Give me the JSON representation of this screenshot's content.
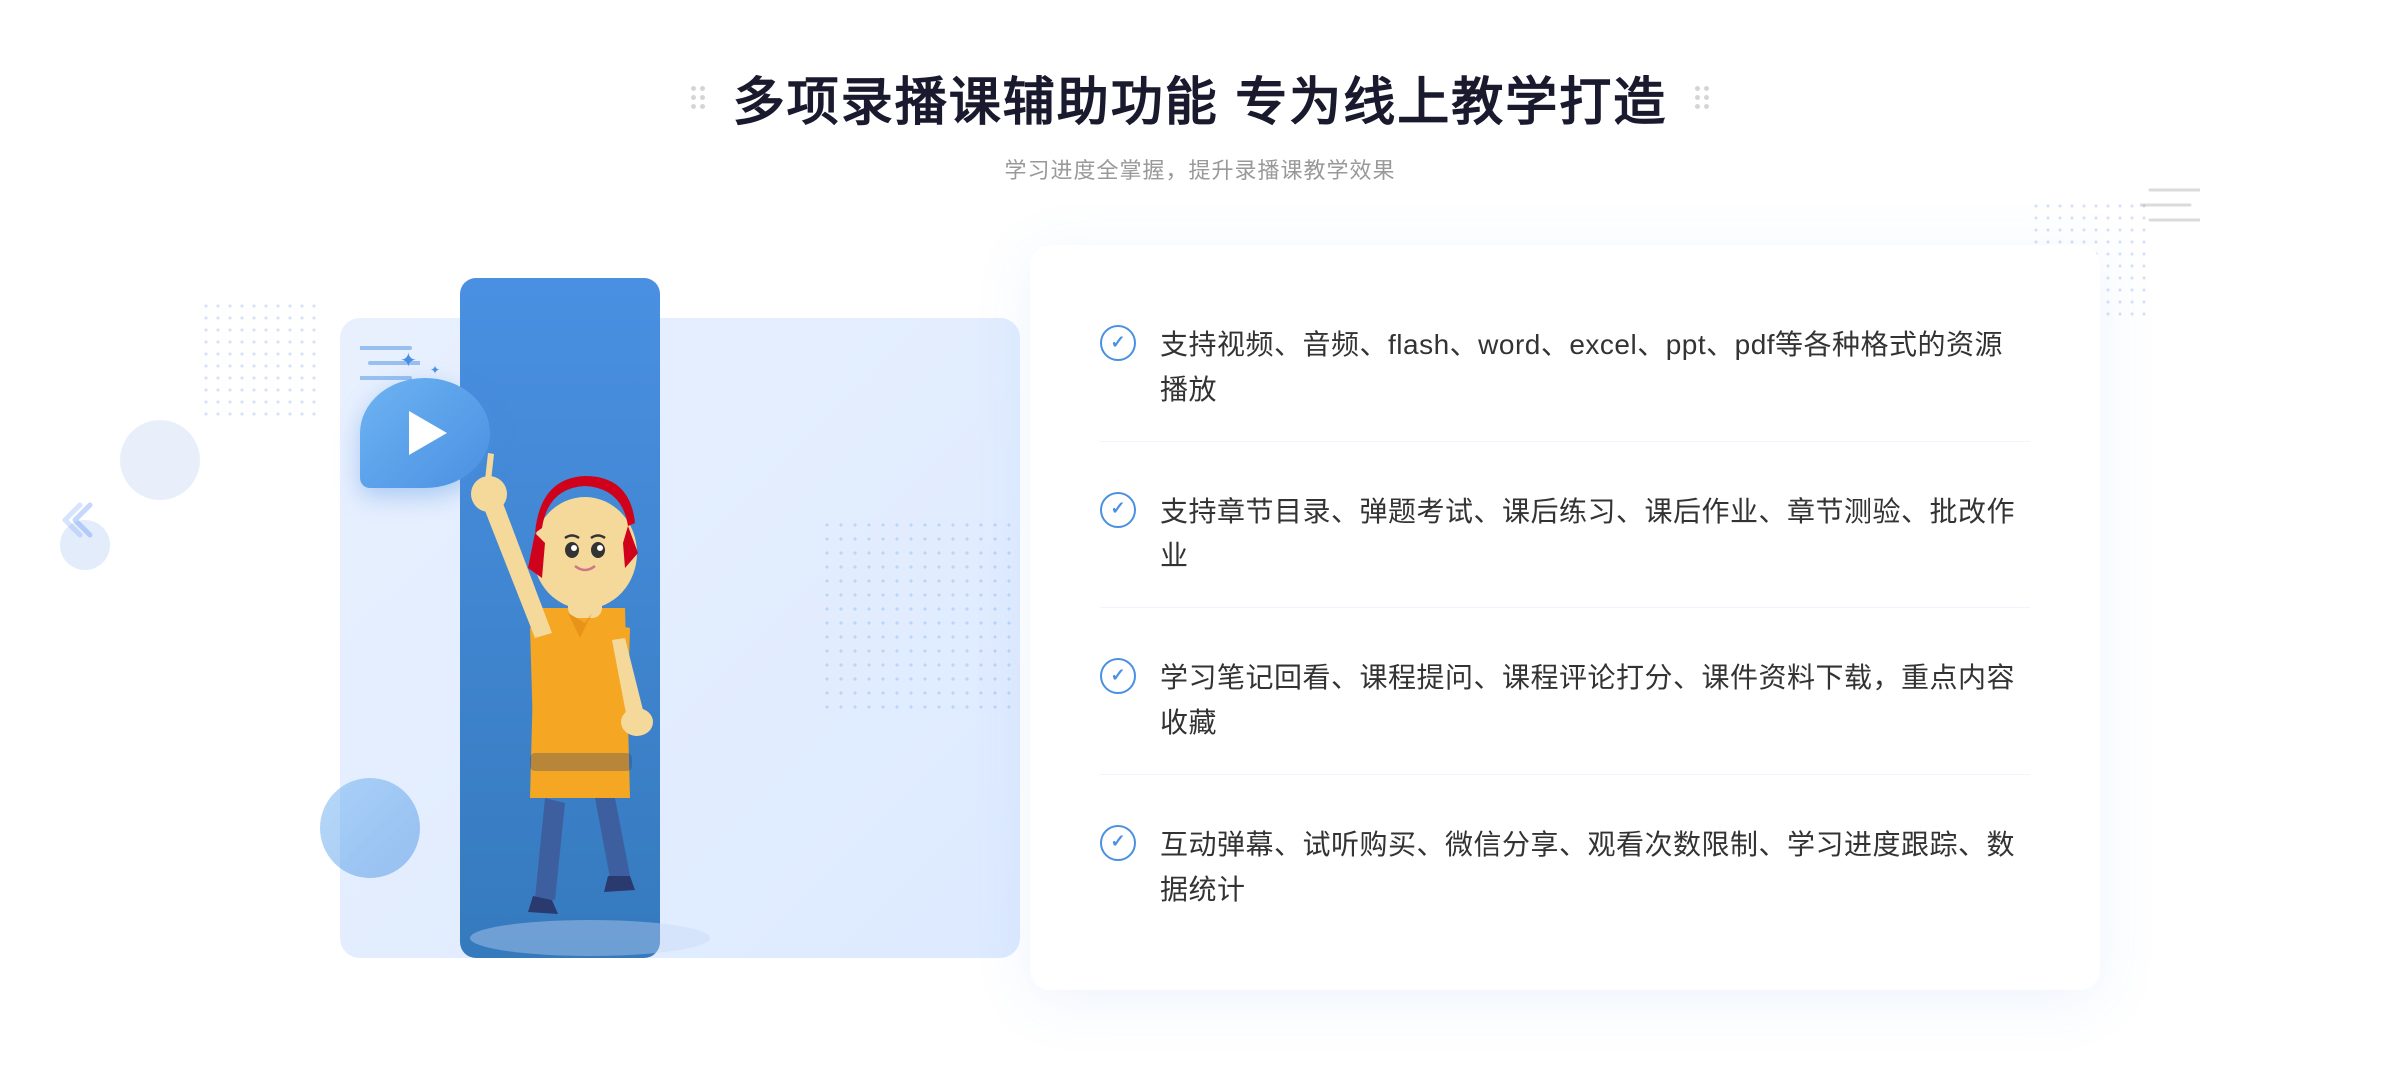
{
  "header": {
    "title": "多项录播课辅助功能 专为线上教学打造",
    "subtitle": "学习进度全掌握，提升录播课教学效果"
  },
  "features": [
    {
      "id": "feature-1",
      "text": "支持视频、音频、flash、word、excel、ppt、pdf等各种格式的资源播放"
    },
    {
      "id": "feature-2",
      "text": "支持章节目录、弹题考试、课后练习、课后作业、章节测验、批改作业"
    },
    {
      "id": "feature-3",
      "text": "学习笔记回看、课程提问、课程评论打分、课件资料下载，重点内容收藏"
    },
    {
      "id": "feature-4",
      "text": "互动弹幕、试听购买、微信分享、观看次数限制、学习进度跟踪、数据统计"
    }
  ],
  "colors": {
    "primary": "#4a90e2",
    "title": "#1a1a2e",
    "text": "#333333",
    "subtitle": "#999999",
    "light_blue": "#e8f0fe"
  }
}
